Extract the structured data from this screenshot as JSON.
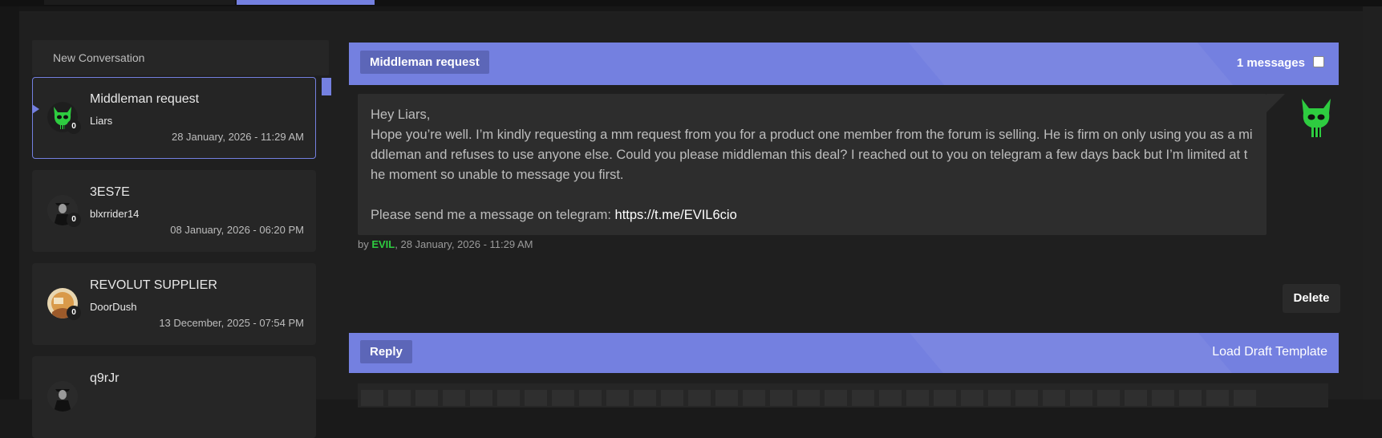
{
  "sidebar": {
    "new_conversation_label": "New Conversation",
    "conversations": [
      {
        "title": "Middleman request",
        "user": "Liars",
        "date": "28 January, 2026 - 11:29 AM",
        "unread": "0",
        "active": true,
        "avatar": "green-skull-icon"
      },
      {
        "title": "3ES7E",
        "user": "blxrrider14",
        "date": "08 January, 2026 - 06:20 PM",
        "unread": "0",
        "avatar": "dark-figure-avatar"
      },
      {
        "title": "REVOLUT SUPPLIER",
        "user": "DoorDush",
        "date": "13 December, 2025 - 07:54 PM",
        "unread": "0",
        "avatar": "cartoon-avatar"
      },
      {
        "title": "q9rJr",
        "user": "",
        "date": "",
        "unread": "",
        "avatar": "dark-figure-avatar"
      }
    ]
  },
  "thread": {
    "title": "Middleman request",
    "message_count_label": "1 messages",
    "message": {
      "greeting": "Hey Liars,",
      "paragraph": "Hope you’re well. I’m kindly requesting a mm request from you for a product one member from the forum is selling. He is firm on only using you as a middleman and refuses to use anyone else. Could you please middleman this deal? I reached out to you on telegram a few days back but I’m limited at the moment so unable to message you first.",
      "contact_prefix": "Please send me a message on telegram: ",
      "contact_link": "https://t.me/EVIL6cio"
    },
    "byline": {
      "prefix": "by ",
      "author": "EVIL",
      "date": ", 28 January, 2026 - 11:29 AM"
    },
    "delete_label": "Delete"
  },
  "reply": {
    "title": "Reply",
    "load_draft_label": "Load Draft Template"
  },
  "colors": {
    "accent": "#7480e0",
    "author": "#2ecc40",
    "background": "#202020"
  }
}
